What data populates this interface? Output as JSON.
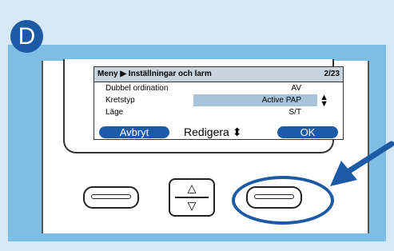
{
  "badge": {
    "letter": "D"
  },
  "screen": {
    "breadcrumb": "Meny ▶ Inställningar och larm",
    "page": "2/23",
    "rows": [
      {
        "label": "Dubbel ordination",
        "value": "AV"
      },
      {
        "label": "Kretstyp",
        "value": "Active PAP",
        "selected": true
      },
      {
        "label": "Läge",
        "value": "S/T"
      }
    ],
    "softkeys": {
      "left": "Avbryt",
      "middle": "Redigera ⬍",
      "right": "OK"
    }
  },
  "colors": {
    "accent": "#1c5aa6",
    "panel": "#7dbfe4",
    "background": "#d6e8f5",
    "highlight": "#a9c4d8"
  }
}
